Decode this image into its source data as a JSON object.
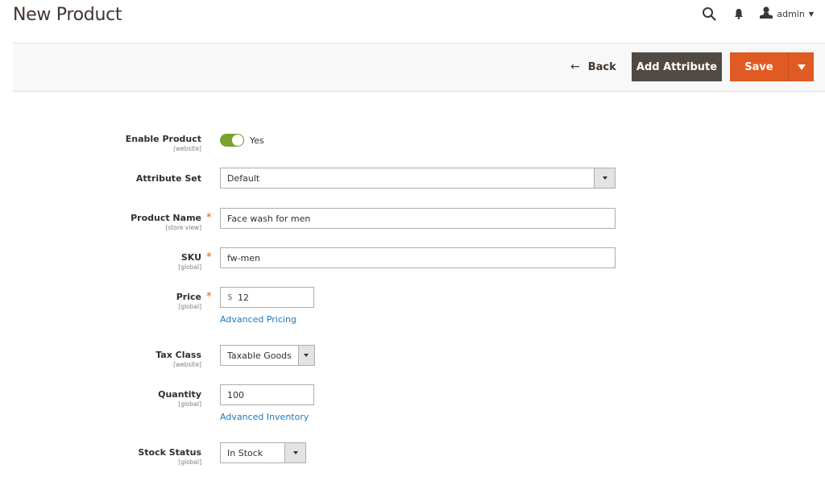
{
  "header": {
    "title": "New Product",
    "user_name": "admin",
    "icons": {
      "search": "search-icon",
      "notifications": "bell-icon",
      "user": "user-icon",
      "user_caret": "chevron-down-icon"
    }
  },
  "actions": {
    "back_arrow": "←",
    "back_label": "Back",
    "add_attribute_label": "Add Attribute",
    "save_label": "Save"
  },
  "colors": {
    "primary_button": "#e05a23",
    "secondary_button": "#514943",
    "toggle_on": "#79a22e",
    "link": "#1979c3",
    "required": "#eb5202"
  },
  "form": {
    "enable_product": {
      "label": "Enable Product",
      "scope": "[website]",
      "value": "Yes",
      "enabled": true
    },
    "attribute_set": {
      "label": "Attribute Set",
      "value": "Default"
    },
    "product_name": {
      "label": "Product Name",
      "scope": "[store view]",
      "required": "*",
      "value": "Face wash for men"
    },
    "sku": {
      "label": "SKU",
      "scope": "[global]",
      "required": "*",
      "value": "fw-men"
    },
    "price": {
      "label": "Price",
      "scope": "[global]",
      "required": "*",
      "currency": "$",
      "value": "12",
      "link": "Advanced Pricing"
    },
    "tax_class": {
      "label": "Tax Class",
      "scope": "[website]",
      "value": "Taxable Goods"
    },
    "quantity": {
      "label": "Quantity",
      "scope": "[global]",
      "value": "100",
      "link": "Advanced Inventory"
    },
    "stock_status": {
      "label": "Stock Status",
      "scope": "[global]",
      "value": "In Stock"
    }
  }
}
